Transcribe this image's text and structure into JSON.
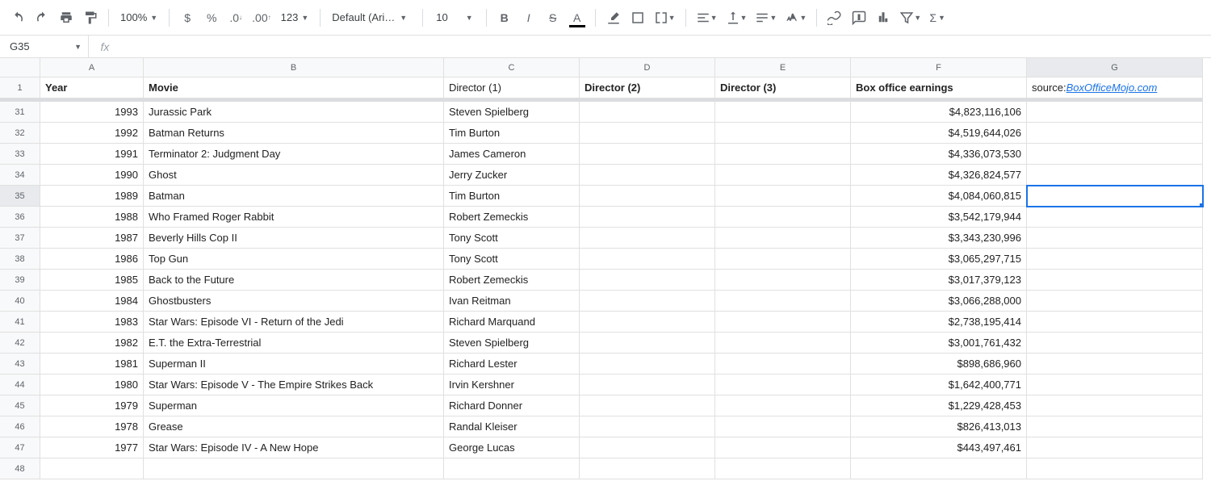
{
  "toolbar": {
    "zoom": "100%",
    "font": "Default (Ari…",
    "fontsize": "10",
    "number_format": "123"
  },
  "namebox": "G35",
  "fx_placeholder": "",
  "columns": [
    "A",
    "B",
    "C",
    "D",
    "E",
    "F",
    "G"
  ],
  "selected_col": "G",
  "headers": {
    "A": "Year",
    "B": "Movie",
    "C": "Director (1)",
    "D": "Director (2)",
    "E": "Director (3)",
    "F": "Box office earnings",
    "G_prefix": "source: ",
    "G_link": "BoxOfficeMojo.com"
  },
  "header_bold": {
    "A": true,
    "B": true,
    "C": false,
    "D": true,
    "E": true,
    "F": true,
    "G": false
  },
  "selected_row": 35,
  "row_numbers": [
    31,
    32,
    33,
    34,
    35,
    36,
    37,
    38,
    39,
    40,
    41,
    42,
    43,
    44,
    45,
    46,
    47,
    48
  ],
  "rows": [
    {
      "year": "1993",
      "movie": "Jurassic Park",
      "d1": "Steven Spielberg",
      "d2": "",
      "d3": "",
      "box": "$4,823,116,106"
    },
    {
      "year": "1992",
      "movie": "Batman Returns",
      "d1": "Tim Burton",
      "d2": "",
      "d3": "",
      "box": "$4,519,644,026"
    },
    {
      "year": "1991",
      "movie": "Terminator 2: Judgment Day",
      "d1": "James Cameron",
      "d2": "",
      "d3": "",
      "box": "$4,336,073,530"
    },
    {
      "year": "1990",
      "movie": "Ghost",
      "d1": "Jerry Zucker",
      "d2": "",
      "d3": "",
      "box": "$4,326,824,577"
    },
    {
      "year": "1989",
      "movie": "Batman",
      "d1": "Tim Burton",
      "d2": "",
      "d3": "",
      "box": "$4,084,060,815"
    },
    {
      "year": "1988",
      "movie": "Who Framed Roger Rabbit",
      "d1": "Robert Zemeckis",
      "d2": "",
      "d3": "",
      "box": "$3,542,179,944"
    },
    {
      "year": "1987",
      "movie": "Beverly Hills Cop II",
      "d1": "Tony Scott",
      "d2": "",
      "d3": "",
      "box": "$3,343,230,996"
    },
    {
      "year": "1986",
      "movie": "Top Gun",
      "d1": "Tony Scott",
      "d2": "",
      "d3": "",
      "box": "$3,065,297,715"
    },
    {
      "year": "1985",
      "movie": "Back to the Future",
      "d1": "Robert Zemeckis",
      "d2": "",
      "d3": "",
      "box": "$3,017,379,123"
    },
    {
      "year": "1984",
      "movie": "Ghostbusters",
      "d1": "Ivan Reitman",
      "d2": "",
      "d3": "",
      "box": "$3,066,288,000"
    },
    {
      "year": "1983",
      "movie": "Star Wars: Episode VI - Return of the Jedi",
      "d1": "Richard Marquand",
      "d2": "",
      "d3": "",
      "box": "$2,738,195,414"
    },
    {
      "year": "1982",
      "movie": "E.T. the Extra-Terrestrial",
      "d1": "Steven Spielberg",
      "d2": "",
      "d3": "",
      "box": "$3,001,761,432"
    },
    {
      "year": "1981",
      "movie": "Superman II",
      "d1": "Richard Lester",
      "d2": "",
      "d3": "",
      "box": "$898,686,960"
    },
    {
      "year": "1980",
      "movie": "Star Wars: Episode V - The Empire Strikes Back",
      "d1": "Irvin Kershner",
      "d2": "",
      "d3": "",
      "box": "$1,642,400,771"
    },
    {
      "year": "1979",
      "movie": "Superman",
      "d1": "Richard Donner",
      "d2": "",
      "d3": "",
      "box": "$1,229,428,453"
    },
    {
      "year": "1978",
      "movie": "Grease",
      "d1": "Randal Kleiser",
      "d2": "",
      "d3": "",
      "box": "$826,413,013"
    },
    {
      "year": "1977",
      "movie": "Star Wars: Episode IV - A New Hope",
      "d1": "George Lucas",
      "d2": "",
      "d3": "",
      "box": "$443,497,461"
    },
    {
      "year": "",
      "movie": "",
      "d1": "",
      "d2": "",
      "d3": "",
      "box": ""
    }
  ]
}
